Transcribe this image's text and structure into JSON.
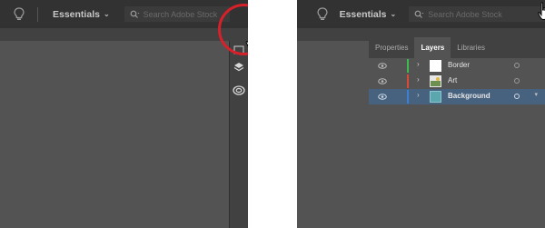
{
  "left": {
    "workspace": {
      "label": "Essentials",
      "chevron": "⌄"
    },
    "search": {
      "placeholder": "Search Adobe Stock"
    },
    "toolstrip": {
      "icons": [
        "libraries-icon",
        "layers-icon",
        "creative-cloud-libraries-icon"
      ]
    },
    "highlight_color": "#d8202a"
  },
  "right": {
    "workspace": {
      "label": "Essentials",
      "chevron": "⌄"
    },
    "search": {
      "placeholder": "Search Adobe Stock"
    },
    "tabs": [
      {
        "label": "Properties",
        "active": false
      },
      {
        "label": "Layers",
        "active": true
      },
      {
        "label": "Libraries",
        "active": false
      }
    ],
    "layers": [
      {
        "name": "Border",
        "color": "#3dbb4f",
        "selected": false,
        "thumb": "white"
      },
      {
        "name": "Art",
        "color": "#d84a36",
        "selected": false,
        "thumb": "art"
      },
      {
        "name": "Background",
        "color": "#3f7fd0",
        "selected": true,
        "thumb": "teal"
      }
    ]
  }
}
